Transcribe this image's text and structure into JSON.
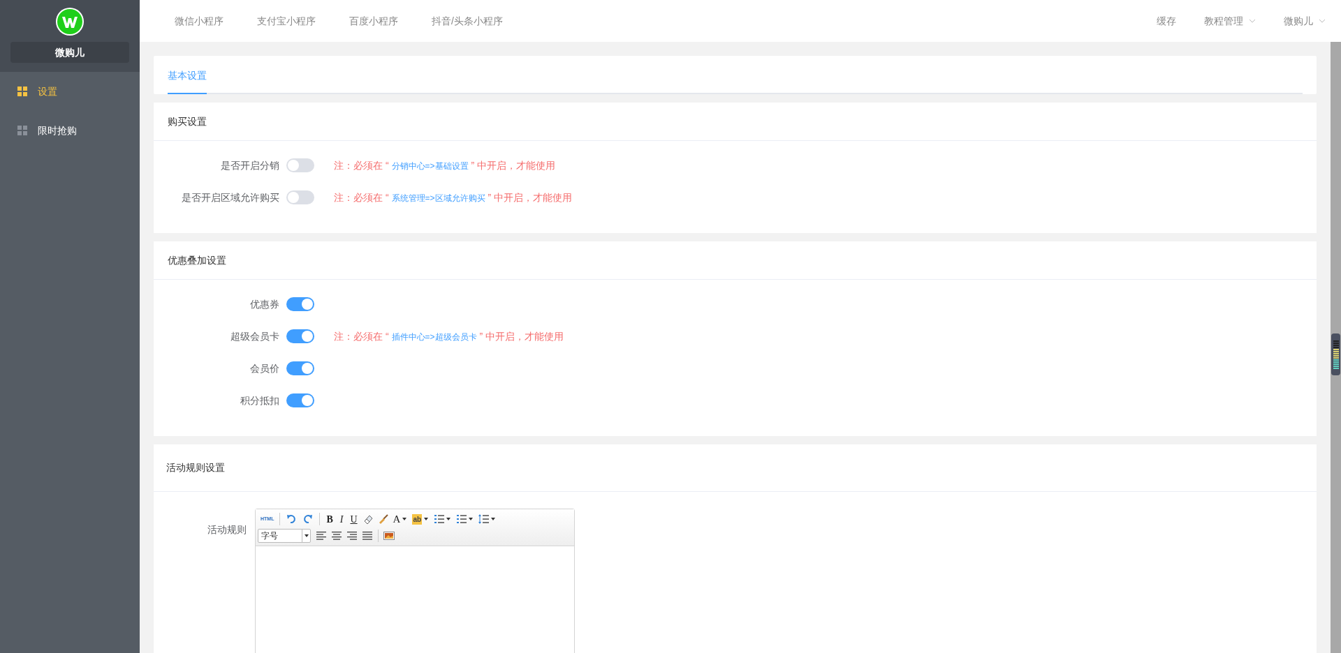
{
  "sidebar": {
    "brand": "微购儿",
    "items": [
      {
        "label": "设置",
        "selected": true
      },
      {
        "label": "限时抢购",
        "selected": false
      }
    ]
  },
  "topnav": {
    "links": [
      "微信小程序",
      "支付宝小程序",
      "百度小程序",
      "抖音/头条小程序"
    ],
    "right": [
      {
        "label": "缓存",
        "dropdown": false
      },
      {
        "label": "教程管理",
        "dropdown": true
      },
      {
        "label": "微购儿",
        "dropdown": true
      }
    ]
  },
  "tabs": [
    {
      "label": "基本设置",
      "selected": true
    }
  ],
  "sections": [
    {
      "title": "购买设置",
      "rows": [
        {
          "label": "是否开启分销",
          "on": false,
          "note": {
            "prefix": "注：必须在 “",
            "link": "分销中心=>基础设置",
            "suffix": "” 中开启，才能使用"
          }
        },
        {
          "label": "是否开启区域允许购买",
          "on": false,
          "note": {
            "prefix": "注：必须在 “",
            "link": "系统管理=>区域允许购买",
            "suffix": "” 中开启，才能使用"
          }
        }
      ]
    },
    {
      "title": "优惠叠加设置",
      "rows": [
        {
          "label": "优惠券",
          "on": true
        },
        {
          "label": "超级会员卡",
          "on": true,
          "note": {
            "prefix": "注：必须在 “",
            "link": "插件中心=>超级会员卡",
            "suffix": "” 中开启，才能使用"
          }
        },
        {
          "label": "会员价",
          "on": true
        },
        {
          "label": "积分抵扣",
          "on": true
        }
      ]
    }
  ],
  "activity": {
    "title": "活动规则设置",
    "field_label": "活动规则",
    "toolbar": [
      [
        {
          "kind": "html",
          "label": "HTML"
        },
        {
          "kind": "sep"
        },
        {
          "kind": "undo"
        },
        {
          "kind": "redo"
        },
        {
          "kind": "sep"
        },
        {
          "kind": "bold",
          "label": "B"
        },
        {
          "kind": "italic",
          "label": "I"
        },
        {
          "kind": "underline",
          "label": "U"
        },
        {
          "kind": "eraser"
        },
        {
          "kind": "brush"
        },
        {
          "kind": "fontcolor",
          "label": "A"
        },
        {
          "kind": "highlight",
          "label": "ab"
        },
        {
          "kind": "olist"
        },
        {
          "kind": "ulist"
        },
        {
          "kind": "lineheight"
        }
      ],
      [
        {
          "kind": "select",
          "label": "字号"
        },
        {
          "kind": "alignleft"
        },
        {
          "kind": "aligncenter"
        },
        {
          "kind": "alignright"
        },
        {
          "kind": "justify"
        },
        {
          "kind": "sep"
        },
        {
          "kind": "image"
        }
      ]
    ]
  }
}
